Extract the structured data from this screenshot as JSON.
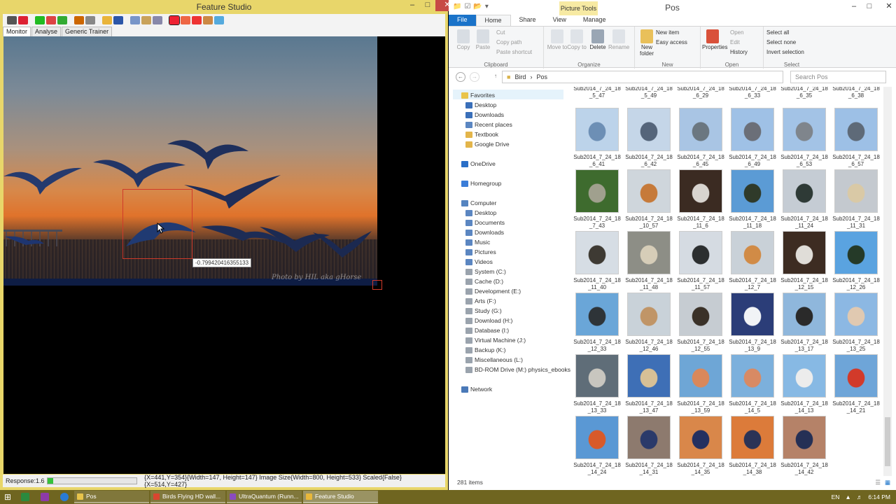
{
  "left_window": {
    "title": "Feature Studio",
    "controls": {
      "minimize": "–",
      "maximize": "□",
      "close": "✕"
    },
    "tabs": [
      "Monitor",
      "Analyse",
      "Generic Trainer"
    ],
    "tooltip_value": "-0.799420416355133",
    "watermark": "Photo by HIL aka gHorse",
    "status": {
      "response_label": "Response:1.6",
      "response_fraction": 0.07,
      "info": "{X=441,Y=354}{Width=147, Height=147}  Image Size{Width=800, Height=533} Scaled{False}  {X=514,Y=427}"
    }
  },
  "right_window": {
    "title": "Pos",
    "context_tab": "Picture Tools",
    "ribbon_tabs": [
      "File",
      "Home",
      "Share",
      "View",
      "Manage"
    ],
    "ribbon": {
      "clipboard": {
        "label": "Clipboard",
        "copy": "Copy",
        "paste": "Paste",
        "cut": "Cut",
        "copy_path": "Copy path",
        "paste_shortcut": "Paste shortcut"
      },
      "organize": {
        "label": "Organize",
        "move_to": "Move to",
        "copy_to": "Copy to",
        "delete": "Delete",
        "rename": "Rename"
      },
      "new": {
        "label": "New",
        "new_folder": "New folder",
        "new_item": "New item",
        "easy_access": "Easy access"
      },
      "open": {
        "label": "Open",
        "properties": "Properties",
        "open": "Open",
        "edit": "Edit",
        "history": "History"
      },
      "select": {
        "label": "Select",
        "select_all": "Select all",
        "select_none": "Select none",
        "invert": "Invert selection"
      }
    },
    "address": {
      "path": [
        "Bird",
        "Pos"
      ],
      "search_placeholder": "Search Pos"
    },
    "nav": {
      "favorites": "Favorites",
      "favorites_items": [
        "Desktop",
        "Downloads",
        "Recent places",
        "Textbook",
        "Google Drive"
      ],
      "onedrive": "OneDrive",
      "homegroup": "Homegroup",
      "computer": "Computer",
      "computer_items": [
        "Desktop",
        "Documents",
        "Downloads",
        "Music",
        "Pictures",
        "Videos",
        "System (C:)",
        "Cache (D:)",
        "Development (E:)",
        "Arts (F:)",
        "Study (G:)",
        "Download (H:)",
        "Database (I:)",
        "Virtual Machine (J:)",
        "Backup (K:)",
        "Miscellaneous (L:)",
        "BD-ROM Drive (M:) physics_ebooks"
      ],
      "network": "Network"
    },
    "top_captions": [
      [
        "Sub2014_7_24_18",
        "_5_47"
      ],
      [
        "Sub2014_7_24_18",
        "_5_49"
      ],
      [
        "Sub2014_7_24_18",
        "_6_29"
      ],
      [
        "Sub2014_7_24_18",
        "_6_33"
      ],
      [
        "Sub2014_7_24_18",
        "_6_35"
      ],
      [
        "Sub2014_7_24_18",
        "_6_38"
      ]
    ],
    "thumbnails": [
      {
        "l1": "Sub2014_7_24_18",
        "l2": "_6_41",
        "c1": "#bcd3ea",
        "c2": "#6d8fb5"
      },
      {
        "l1": "Sub2014_7_24_18",
        "l2": "_6_42",
        "c1": "#c5d6e8",
        "c2": "#55657a"
      },
      {
        "l1": "Sub2014_7_24_18",
        "l2": "_6_45",
        "c1": "#a9c5e4",
        "c2": "#6b7780"
      },
      {
        "l1": "Sub2014_7_24_18",
        "l2": "_6_49",
        "c1": "#9fc1e6",
        "c2": "#6b6f78"
      },
      {
        "l1": "Sub2014_7_24_18",
        "l2": "_6_53",
        "c1": "#a3c3e6",
        "c2": "#7f858c"
      },
      {
        "l1": "Sub2014_7_24_18",
        "l2": "_6_57",
        "c1": "#9dc0e6",
        "c2": "#5e6a78"
      },
      {
        "l1": "Sub2014_7_24_18",
        "l2": "_7_43",
        "c1": "#3e6b2e",
        "c2": "#a0a08e"
      },
      {
        "l1": "Sub2014_7_24_18",
        "l2": "_10_57",
        "c1": "#cfd6dc",
        "c2": "#c67a3a"
      },
      {
        "l1": "Sub2014_7_24_18",
        "l2": "_11_6",
        "c1": "#3b2b22",
        "c2": "#d8d4cf"
      },
      {
        "l1": "Sub2014_7_24_18",
        "l2": "_11_18",
        "c1": "#5b9bd5",
        "c2": "#2f3a2a"
      },
      {
        "l1": "Sub2014_7_24_18",
        "l2": "_11_24",
        "c1": "#c5ccd4",
        "c2": "#2e3a36"
      },
      {
        "l1": "Sub2014_7_24_18",
        "l2": "_11_31",
        "c1": "#c4c9cf",
        "c2": "#d9c9a6"
      },
      {
        "l1": "Sub2014_7_24_18",
        "l2": "_11_40",
        "c1": "#d6dde4",
        "c2": "#3e3a33"
      },
      {
        "l1": "Sub2014_7_24_18",
        "l2": "_11_48",
        "c1": "#8d8e86",
        "c2": "#d6cdb8"
      },
      {
        "l1": "Sub2014_7_24_18",
        "l2": "_11_57",
        "c1": "#d5dbe2",
        "c2": "#2c2f30"
      },
      {
        "l1": "Sub2014_7_24_18",
        "l2": "_12_7",
        "c1": "#c9d1d8",
        "c2": "#d18b46"
      },
      {
        "l1": "Sub2014_7_24_18",
        "l2": "_12_15",
        "c1": "#3d2c22",
        "c2": "#e0ddd8"
      },
      {
        "l1": "Sub2014_7_24_18",
        "l2": "_12_26",
        "c1": "#5aa3e0",
        "c2": "#253a28"
      },
      {
        "l1": "Sub2014_7_24_18",
        "l2": "_12_33",
        "c1": "#6aa6d8",
        "c2": "#2e3438"
      },
      {
        "l1": "Sub2014_7_24_18",
        "l2": "_12_46",
        "c1": "#c9d2d9",
        "c2": "#c09567"
      },
      {
        "l1": "Sub2014_7_24_18",
        "l2": "_12_55",
        "c1": "#c6ccd2",
        "c2": "#3a3128"
      },
      {
        "l1": "Sub2014_7_24_18",
        "l2": "_13_9",
        "c1": "#2b3d78",
        "c2": "#f1f3f6"
      },
      {
        "l1": "Sub2014_7_24_18",
        "l2": "_13_17",
        "c1": "#8fb7dc",
        "c2": "#2a2a2a"
      },
      {
        "l1": "Sub2014_7_24_18",
        "l2": "_13_25",
        "c1": "#8cb8e3",
        "c2": "#e0c9b1"
      },
      {
        "l1": "Sub2014_7_24_18",
        "l2": "_13_33",
        "c1": "#5f6d78",
        "c2": "#c8c6bf"
      },
      {
        "l1": "Sub2014_7_24_18",
        "l2": "_13_47",
        "c1": "#3e6fb6",
        "c2": "#d7c096"
      },
      {
        "l1": "Sub2014_7_24_18",
        "l2": "_13_59",
        "c1": "#6ea6d6",
        "c2": "#d9885b"
      },
      {
        "l1": "Sub2014_7_24_18",
        "l2": "_14_5",
        "c1": "#7cb0dc",
        "c2": "#d88a64"
      },
      {
        "l1": "Sub2014_7_24_18",
        "l2": "_14_13",
        "c1": "#87b9e4",
        "c2": "#ececec"
      },
      {
        "l1": "Sub2014_7_24_18",
        "l2": "_14_21",
        "c1": "#6ea5d8",
        "c2": "#d23a2a"
      },
      {
        "l1": "Sub2014_7_24_18",
        "l2": "_14_24",
        "c1": "#5a98d4",
        "c2": "#d85a2a"
      },
      {
        "l1": "Sub2014_7_24_18",
        "l2": "_14_31",
        "c1": "#8d7a6e",
        "c2": "#2a3a6a"
      },
      {
        "l1": "Sub2014_7_24_18",
        "l2": "_14_35",
        "c1": "#d9874a",
        "c2": "#243060"
      },
      {
        "l1": "Sub2014_7_24_18",
        "l2": "_14_38",
        "c1": "#dc7b3a",
        "c2": "#2b3356"
      },
      {
        "l1": "Sub2014_7_24_18",
        "l2": "_14_42",
        "c1": "#b58268",
        "c2": "#253055"
      }
    ],
    "status": {
      "item_count": "281 items"
    }
  },
  "taskbar": {
    "tasks": [
      {
        "label": "Pos",
        "icon_color": "#e7c34a"
      },
      {
        "label": "Birds Flying HD wall...",
        "icon_color": "#d9452f"
      },
      {
        "label": "UltraQuantum (Runn...",
        "icon_color": "#8a4bbf"
      },
      {
        "label": "Feature Studio",
        "icon_color": "#e8b83a"
      }
    ],
    "lang": "EN",
    "time": "6:14 PM"
  },
  "colors": {
    "accent": "#1a73c9",
    "fs_frame": "#e8d66a",
    "taskbar": "#6f6520",
    "selection": "#d03a2a"
  }
}
